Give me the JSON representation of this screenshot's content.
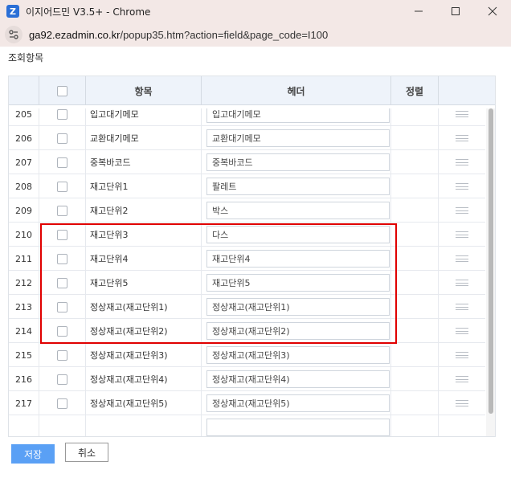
{
  "window": {
    "title": "이지어드민 V3.5+ - Chrome",
    "app_icon_letter": "Z"
  },
  "urlbar": {
    "host": "ga92.ezadmin.co.kr",
    "path": "/popup35.htm?action=field&page_code=I100"
  },
  "section_label": "조회항목",
  "table": {
    "headers": {
      "item": "항목",
      "header": "헤더",
      "sort": "정렬"
    },
    "rows": [
      {
        "no": "205",
        "item": "입고대기메모",
        "header": "입고대기메모"
      },
      {
        "no": "206",
        "item": "교환대기메모",
        "header": "교환대기메모"
      },
      {
        "no": "207",
        "item": "중복바코드",
        "header": "중복바코드"
      },
      {
        "no": "208",
        "item": "재고단위1",
        "header": "팔레트"
      },
      {
        "no": "209",
        "item": "재고단위2",
        "header": "박스"
      },
      {
        "no": "210",
        "item": "재고단위3",
        "header": "다스"
      },
      {
        "no": "211",
        "item": "재고단위4",
        "header": "재고단위4"
      },
      {
        "no": "212",
        "item": "재고단위5",
        "header": "재고단위5"
      },
      {
        "no": "213",
        "item": "정상재고(재고단위1)",
        "header": "정상재고(재고단위1)"
      },
      {
        "no": "214",
        "item": "정상재고(재고단위2)",
        "header": "정상재고(재고단위2)"
      },
      {
        "no": "215",
        "item": "정상재고(재고단위3)",
        "header": "정상재고(재고단위3)"
      },
      {
        "no": "216",
        "item": "정상재고(재고단위4)",
        "header": "정상재고(재고단위4)"
      },
      {
        "no": "217",
        "item": "정상재고(재고단위5)",
        "header": "정상재고(재고단위5)"
      },
      {
        "no": "",
        "item": "",
        "header": ""
      }
    ]
  },
  "footer": {
    "save_label": "저장",
    "cancel_label": "취소"
  },
  "colors": {
    "highlight_border": "#e00000",
    "save_button": "#5aa0f5",
    "titlebar": "#f3e8e6"
  }
}
